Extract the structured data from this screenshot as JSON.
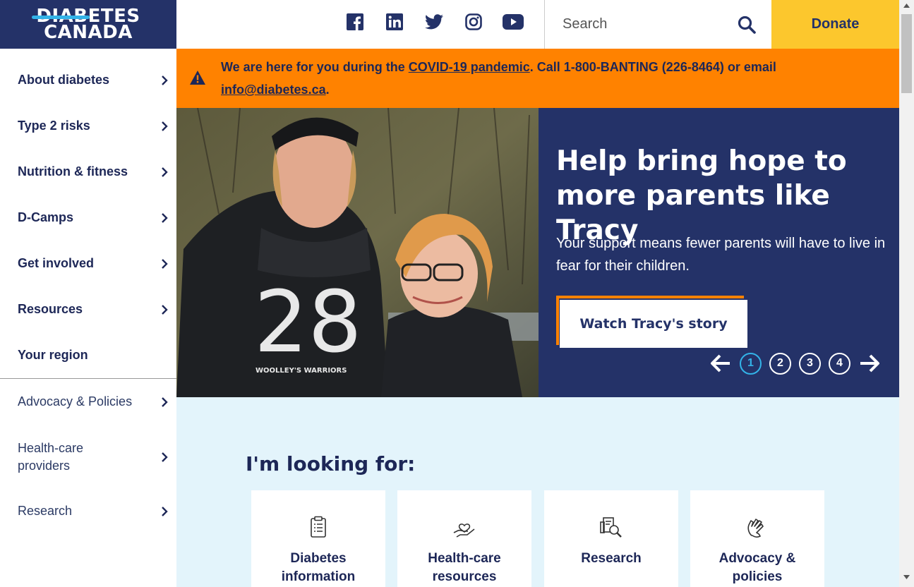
{
  "brand": {
    "logo_line1": "DIABETES",
    "logo_line2": "CANADA",
    "navy": "#243268",
    "accent_blue": "#33b3e8",
    "orange": "#ff8200",
    "yellow": "#fcc72d"
  },
  "header": {
    "social": [
      "facebook-icon",
      "linkedin-icon",
      "twitter-icon",
      "instagram-icon",
      "youtube-icon"
    ],
    "search_placeholder": "Search",
    "donate_label": "Donate"
  },
  "alert": {
    "text_before": "We are here for you during the ",
    "link_covid": "COVID-19 pandemic",
    "text_after": ". Call 1-800-BANTING (226-8464) or email",
    "link_email": "info@diabetes.ca",
    "text_end": "."
  },
  "sidebar": {
    "primary": [
      {
        "label": "About diabetes",
        "has_children": true
      },
      {
        "label": "Type 2 risks",
        "has_children": true
      },
      {
        "label": "Nutrition & fitness",
        "has_children": true
      },
      {
        "label": "D-Camps",
        "has_children": true
      },
      {
        "label": "Get involved",
        "has_children": true
      },
      {
        "label": "Resources",
        "has_children": true
      },
      {
        "label": "Your region",
        "has_children": false
      }
    ],
    "secondary": [
      {
        "label": "Advocacy & Policies"
      },
      {
        "label": "Health-care providers"
      },
      {
        "label": "Research"
      }
    ]
  },
  "hero": {
    "title": "Help bring hope to more parents like Tracy",
    "text": "Your support means fewer parents will have to live in fear for their children.",
    "cta_label": "Watch Tracy's story",
    "slides": [
      "1",
      "2",
      "3",
      "4"
    ],
    "active_slide": "1",
    "image_shirt_number": "28",
    "image_shirt_text": "WOOLLEY'S WARRIORS"
  },
  "looking_for": {
    "title": "I'm looking for:",
    "cards": [
      {
        "label": "Diabetes information",
        "icon": "clipboard-icon"
      },
      {
        "label": "Health-care resources",
        "icon": "heart-hand-icon"
      },
      {
        "label": "Research",
        "icon": "research-search-icon"
      },
      {
        "label": "Advocacy & policies",
        "icon": "raised-hand-icon"
      }
    ]
  }
}
